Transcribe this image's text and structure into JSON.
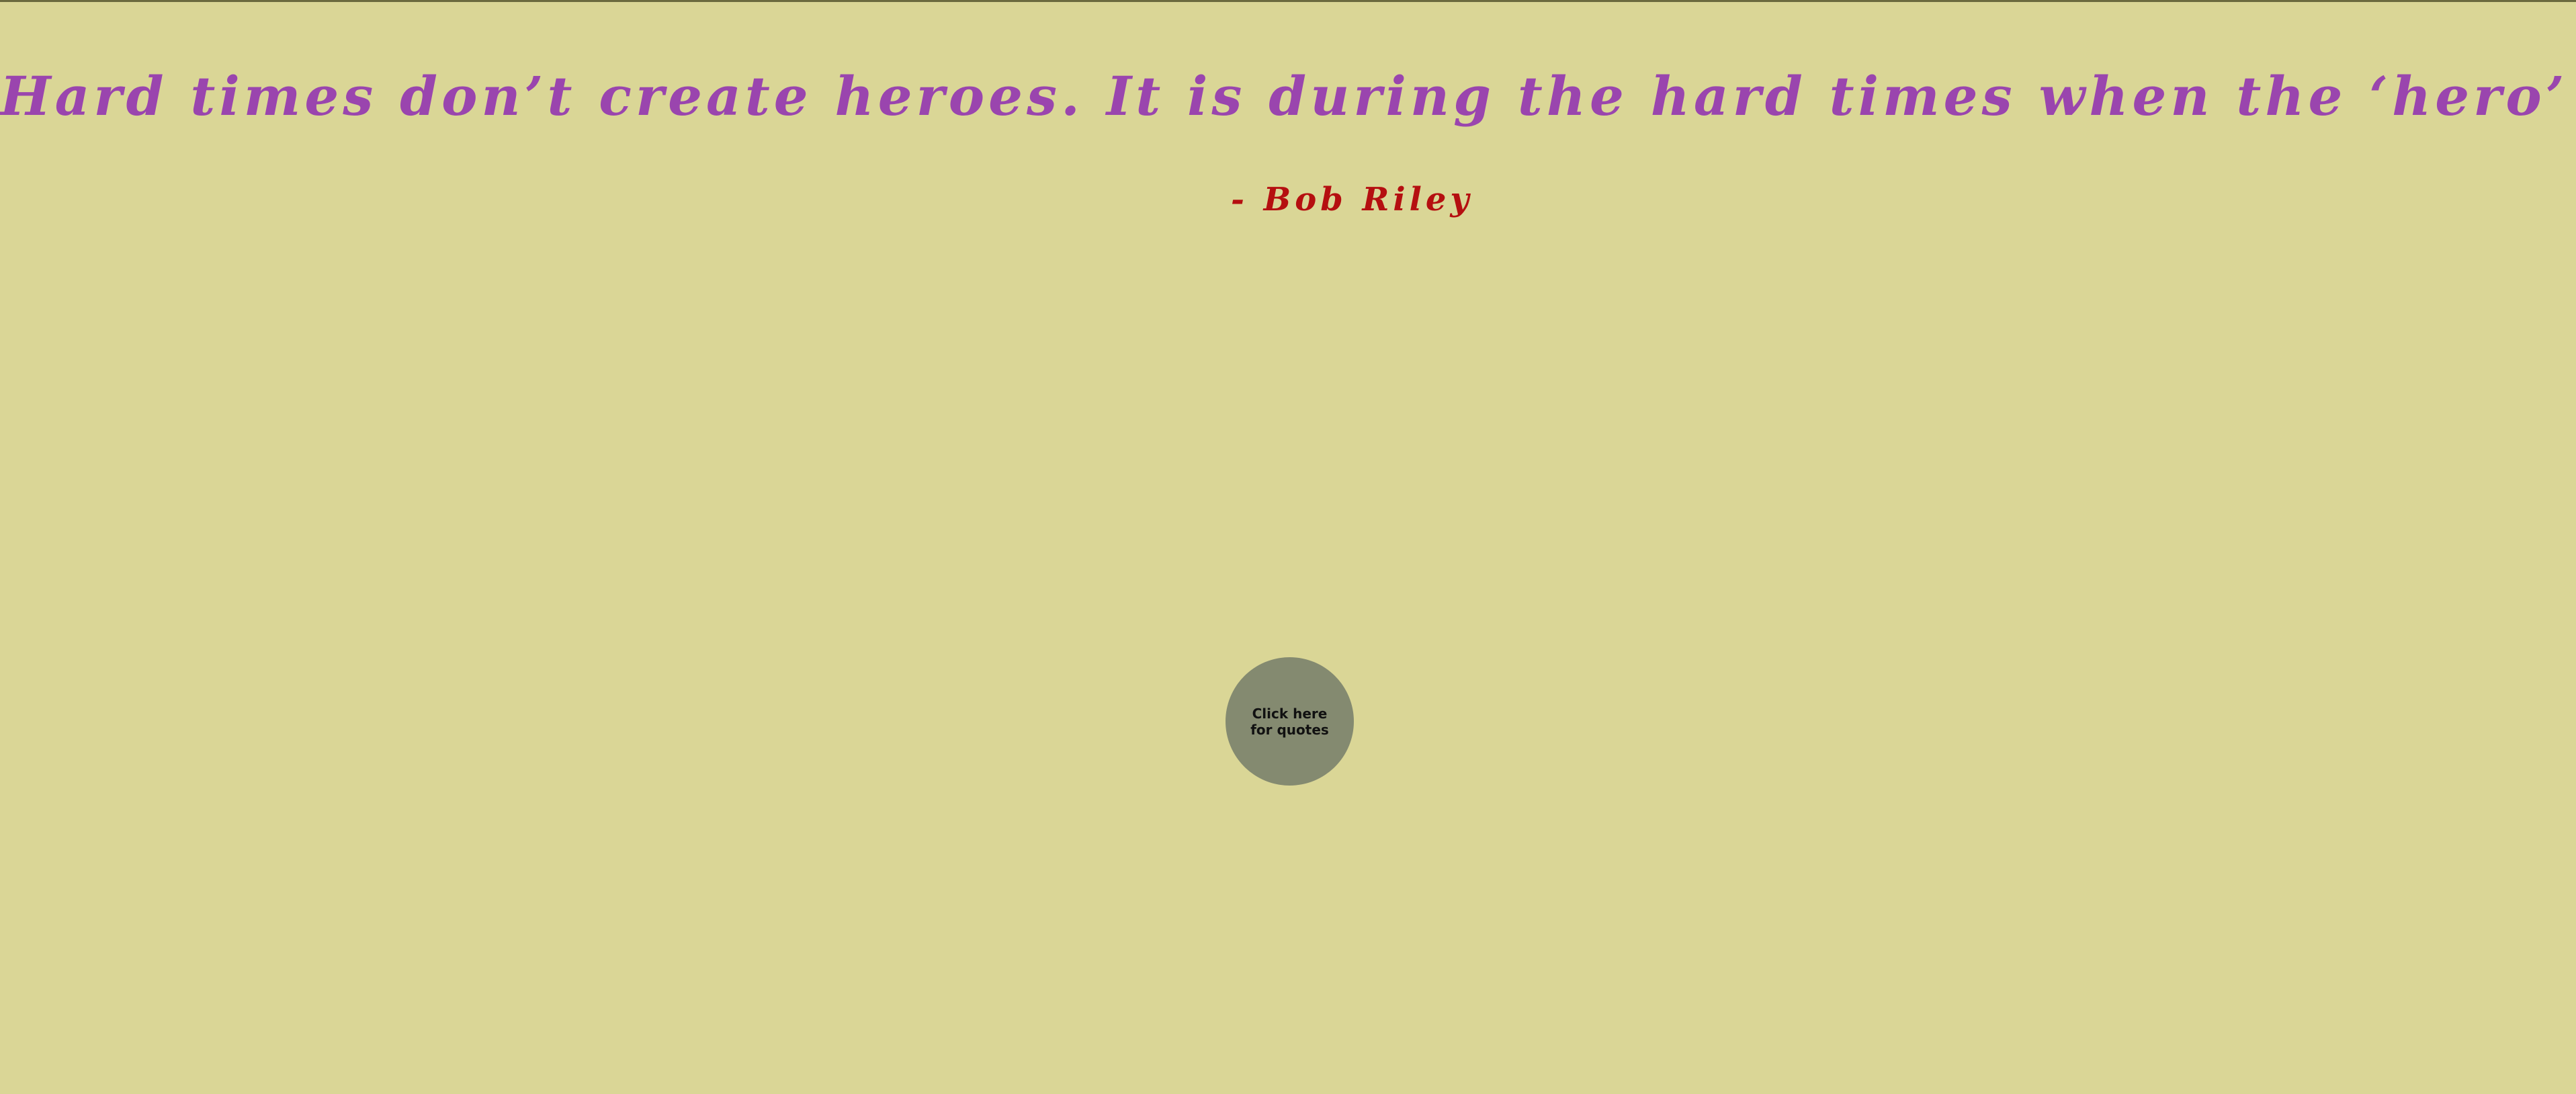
{
  "quote": {
    "text": "Hard times don’t create heroes. It is during the hard times when the ‘hero’ within us is revealed.",
    "author": "- Bob Riley"
  },
  "action": {
    "button_label": "Click here for quotes"
  },
  "colors": {
    "background": "#dad696",
    "quote_text": "#9a45ae",
    "author_text": "#b50f10",
    "button_background": "#848a70"
  }
}
